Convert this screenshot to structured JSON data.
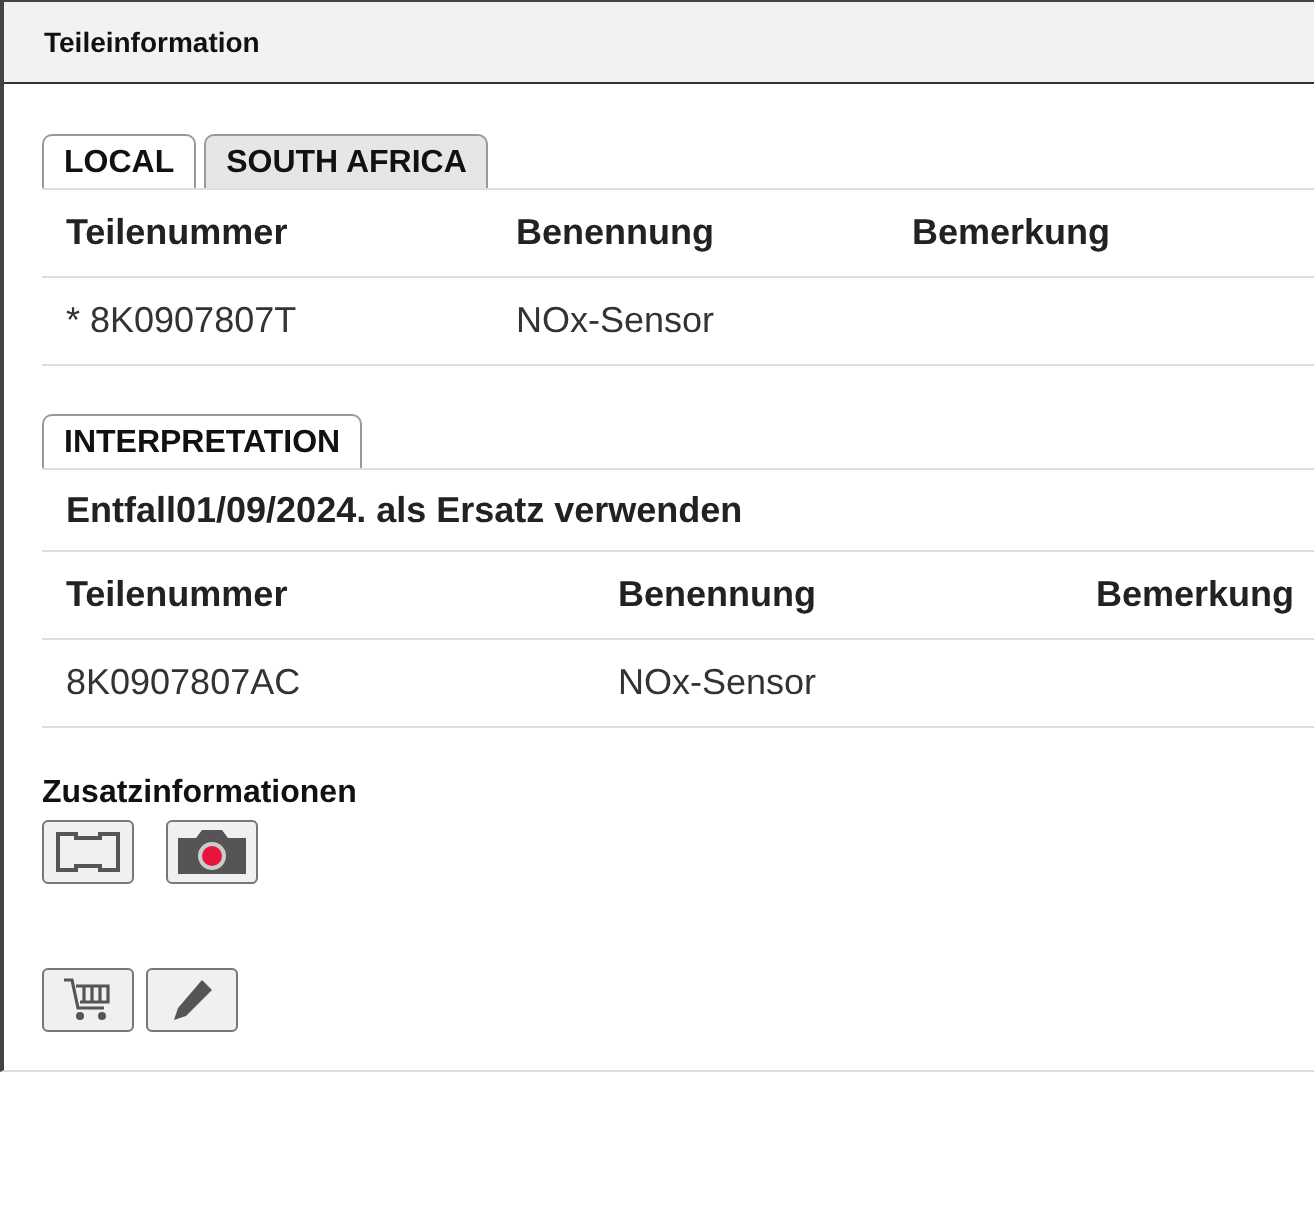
{
  "window": {
    "title": "Teileinformation"
  },
  "region_tabs": [
    {
      "label": "LOCAL",
      "selected": true
    },
    {
      "label": "SOUTH AFRICA",
      "selected": false
    }
  ],
  "parts_table": {
    "columns": [
      "Teilenummer",
      "Benennung",
      "Bemerkung"
    ],
    "rows": [
      [
        "* 8K0907807T",
        "NOx-Sensor",
        ""
      ]
    ]
  },
  "interpretation": {
    "tab": {
      "label": "INTERPRETATION",
      "selected": true
    },
    "note": "Entfall01/09/2024. als Ersatz verwenden",
    "columns": [
      "Teilenummer",
      "Benennung",
      "Bemerkung"
    ],
    "rows": [
      [
        "8K0907807AC",
        "NOx-Sensor",
        ""
      ]
    ]
  },
  "additional_info": {
    "title": "Zusatzinformationen",
    "buttons": [
      {
        "kind": "frame"
      },
      {
        "kind": "camera"
      }
    ]
  },
  "action_buttons": [
    {
      "kind": "cart"
    },
    {
      "kind": "pencil"
    }
  ]
}
